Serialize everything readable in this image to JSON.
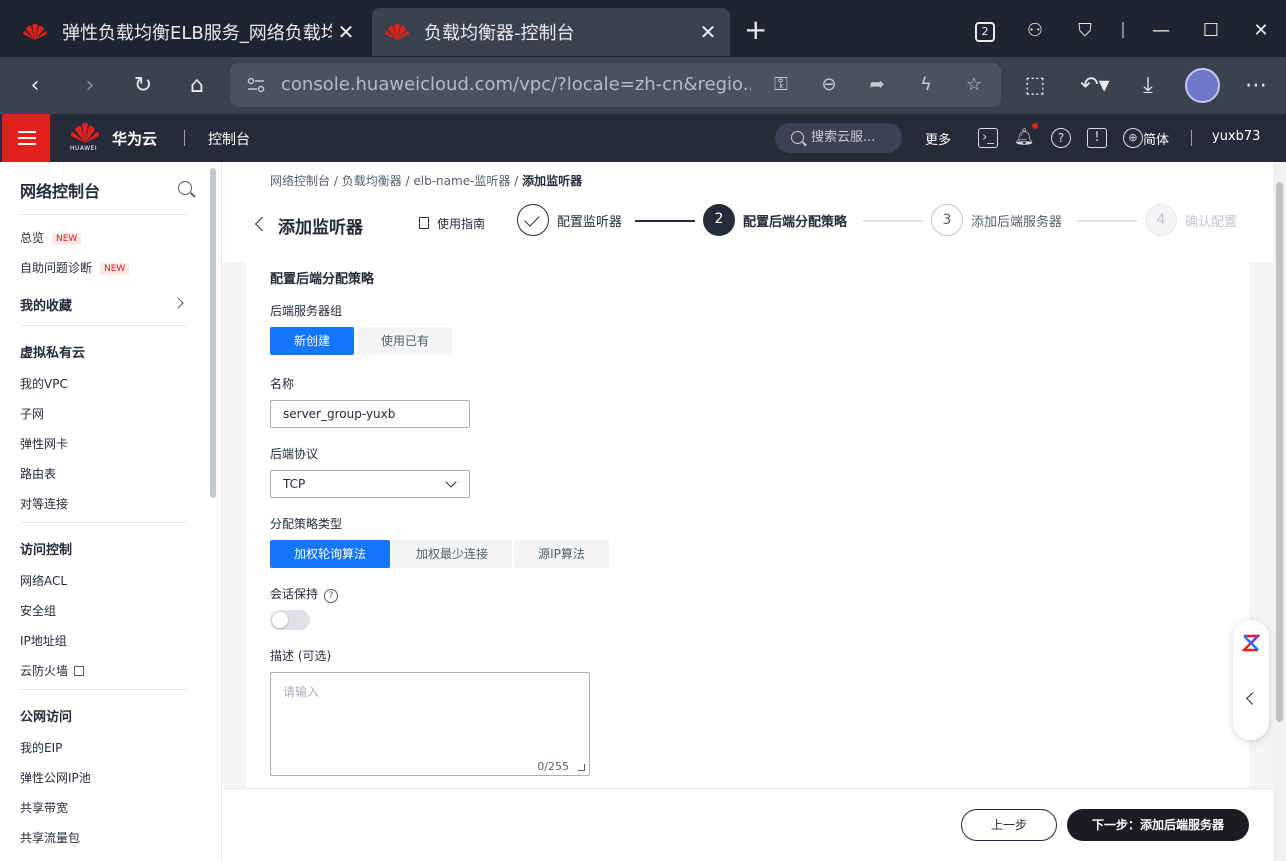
{
  "browser": {
    "tabs": [
      {
        "title": "弹性负载均衡ELB服务_网络负载均",
        "active": false
      },
      {
        "title": "负载均衡器-控制台",
        "active": true
      }
    ],
    "tab_count": "2",
    "url": "console.huaweicloud.com/vpc/?locale=zh-cn&regio..."
  },
  "header": {
    "brand": "华为云",
    "logo_sub": "HUAWEI",
    "console": "控制台",
    "search_placeholder": "搜索云服...",
    "more": "更多",
    "lang": "简体",
    "user": "yuxb73"
  },
  "sidebar": {
    "title": "网络控制台",
    "badge": "NEW",
    "top_items": [
      {
        "label": "总览",
        "new": true
      },
      {
        "label": "自助问题诊断",
        "new": true
      }
    ],
    "favorites": "我的收藏",
    "groups": [
      {
        "title": "虚拟私有云",
        "items": [
          "我的VPC",
          "子网",
          "弹性网卡",
          "路由表",
          "对等连接"
        ]
      },
      {
        "title": "访问控制",
        "items": [
          "网络ACL",
          "安全组",
          "IP地址组",
          "云防火墙"
        ]
      },
      {
        "title": "公网访问",
        "items": [
          "我的EIP",
          "弹性公网IP池",
          "共享带宽",
          "共享流量包"
        ]
      }
    ]
  },
  "breadcrumb": [
    "网络控制台",
    "负载均衡器",
    "elb-name-监听器",
    "添加监听器"
  ],
  "page": {
    "title": "添加监听器",
    "guide": "使用指南"
  },
  "steps": [
    {
      "num": "1",
      "label": "配置监听器",
      "state": "done"
    },
    {
      "num": "2",
      "label": "配置后端分配策略",
      "state": "current"
    },
    {
      "num": "3",
      "label": "添加后端服务器",
      "state": "todo"
    },
    {
      "num": "4",
      "label": "确认配置",
      "state": "disabled"
    }
  ],
  "form": {
    "section_title": "配置后端分配策略",
    "backend_group_label": "后端服务器组",
    "backend_group_options": [
      "新创建",
      "使用已有"
    ],
    "backend_group_selected": "新创建",
    "name_label": "名称",
    "name_value": "server_group-yuxb",
    "protocol_label": "后端协议",
    "protocol_value": "TCP",
    "algorithm_label": "分配策略类型",
    "algorithm_options": [
      "加权轮询算法",
      "加权最少连接",
      "源IP算法"
    ],
    "algorithm_selected": "加权轮询算法",
    "session_label": "会话保持",
    "session_help": "?",
    "session_enabled": false,
    "desc_label": "描述 (可选)",
    "desc_placeholder": "请输入",
    "desc_counter": "0/255"
  },
  "footer": {
    "prev": "上一步",
    "next": "下一步：添加后端服务器"
  },
  "colors": {
    "primary": "#1476ff",
    "header_bg": "#252b3a",
    "brand_red": "#e1211b",
    "next_btn": "#1b1d22"
  }
}
